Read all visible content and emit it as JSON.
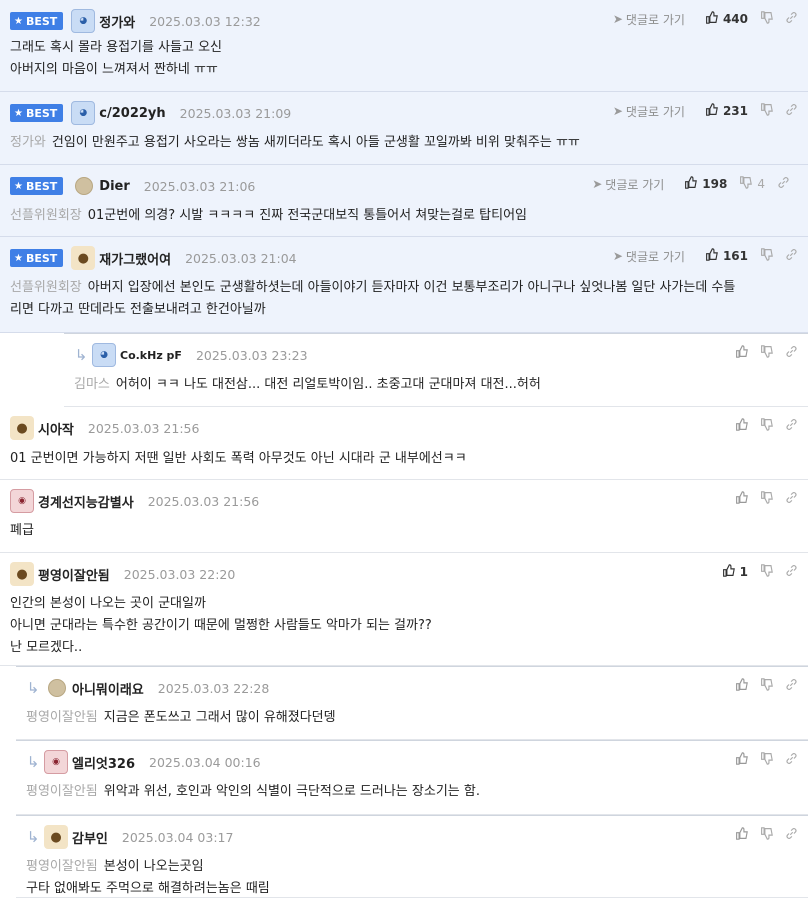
{
  "labels": {
    "best": "BEST",
    "goto_comment": "댓글로 가기"
  },
  "colors": {
    "best_bg": "#eef3fc",
    "badge": "#3f7fe6",
    "reply_arrow": "#9fb3d1"
  },
  "comments": [
    {
      "best": true,
      "nick": "정가와",
      "avatar": "blue-avatar",
      "date": "2025.03.03 12:32",
      "likes": "440",
      "dislikes": "",
      "tag": "",
      "lines": [
        "그래도 혹시 몰라 용접기를 사들고 오신",
        "아버지의 마음이 느껴져서 짠하네 ㅠㅠ"
      ]
    },
    {
      "best": true,
      "nick": "c/2022yh",
      "avatar": "blue-avatar",
      "date": "2025.03.03 21:09",
      "likes": "231",
      "dislikes": "",
      "tag": "정가와",
      "lines": [
        "건임이 만원주고 용접기 사오라는 쌍놈 새끼더라도 혹시 아들 군생활 꼬일까봐 비위 맞춰주는 ㅠㅠ"
      ]
    },
    {
      "best": true,
      "nick": "Dier",
      "avatar": "dot-avatar",
      "date": "2025.03.03 21:06",
      "likes": "198",
      "dislikes": "4",
      "tag": "선플위원회장",
      "lines": [
        "01군번에 의경? 시발 ㅋㅋㅋㅋ 진짜 전국군대보직 통틀어서 쳐맞는걸로 탑티어임"
      ]
    },
    {
      "best": true,
      "nick": "재가그랬어여",
      "avatar": "dog-avatar",
      "date": "2025.03.03 21:04",
      "likes": "161",
      "dislikes": "",
      "tag": "선플위원회장",
      "lines": [
        "아버지 입장에선 본인도 군생활하셧는데 아들이야기 듣자마자 이건 보통부조리가 아니구나 싶엇나봄 일단 사가는데 수틀",
        "리면 다까고 딴데라도 전출보내려고 한건아닐까"
      ]
    },
    {
      "best": false,
      "reply": true,
      "nick": "Co.kHz pF",
      "avatar": "blue-avatar",
      "date": "2025.03.03 23:23",
      "likes": "",
      "dislikes": "",
      "tag": "김마스",
      "lines": [
        "어허이 ㅋㅋ 나도 대전삼... 대전 리얼토박이임.. 초중고대 군대마져 대전...허허"
      ]
    },
    {
      "best": false,
      "nick": "시아작",
      "avatar": "dog-avatar",
      "date": "2025.03.03 21:56",
      "likes": "",
      "dislikes": "",
      "tag": "",
      "lines": [
        "01 군번이면 가능하지 저땐 일반 사회도 폭력 아무것도 아닌 시대라 군 내부에선ㅋㅋ"
      ]
    },
    {
      "best": false,
      "nick": "경계선지능감별사",
      "avatar": "red-avatar",
      "date": "2025.03.03 21:56",
      "likes": "",
      "dislikes": "",
      "tag": "",
      "lines": [
        "폐급"
      ]
    },
    {
      "best": false,
      "nick": "평영이잘안됨",
      "avatar": "dog-avatar",
      "date": "2025.03.03 22:20",
      "likes": "1",
      "dislikes": "",
      "tag": "",
      "lines": [
        "인간의 본성이 나오는 곳이 군대일까",
        "아니면 군대라는 특수한 공간이기 때문에 멀쩡한 사람들도 악마가 되는 걸까??",
        "난 모르겠다.."
      ]
    },
    {
      "best": false,
      "reply": true,
      "nick": "아니뭐이래요",
      "avatar": "dot-avatar",
      "date": "2025.03.03 22:28",
      "likes": "",
      "dislikes": "",
      "tag": "평영이잘안됨",
      "lines": [
        "지금은 폰도쓰고 그래서 많이 유해졌다던뎅"
      ]
    },
    {
      "best": false,
      "reply": true,
      "nick": "엘리엇326",
      "avatar": "red-avatar",
      "date": "2025.03.04 00:16",
      "likes": "",
      "dislikes": "",
      "tag": "평영이잘안됨",
      "lines": [
        "위악과 위선, 호인과 악인의 식별이 극단적으로 드러나는 장소기는 함."
      ]
    },
    {
      "best": false,
      "reply": true,
      "nick": "감부인",
      "avatar": "dog-avatar",
      "date": "2025.03.04 03:17",
      "likes": "",
      "dislikes": "",
      "tag": "평영이잘안됨",
      "lines": [
        "본성이 나오는곳임",
        "구타 없애봐도 주먹으로 해결하려는놈은 때림"
      ]
    }
  ]
}
